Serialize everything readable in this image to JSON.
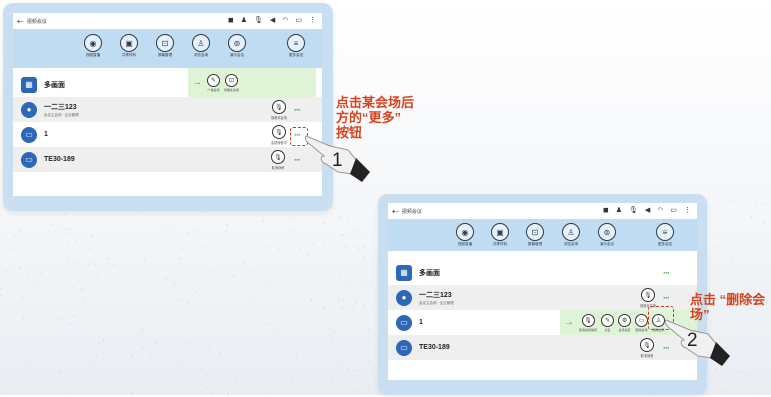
{
  "status": {
    "back_symbol": "⇠",
    "title": "视频会议"
  },
  "toolbar_labels": [
    "视频直播",
    "共享材料",
    "屏幕管理",
    "浏览会场",
    "演示会议",
    "更多会控"
  ],
  "toolbar_icons": [
    "camera-icon",
    "share-icon",
    "screen-icon",
    "participants-icon",
    "present-icon",
    "menu-icon"
  ],
  "rows": {
    "multi": {
      "name": "多画面",
      "more": "···"
    },
    "venue1": {
      "name": "一二三123",
      "sub": "会议主会场 · 企业管理",
      "more": "···",
      "mic_label": "静音本会场"
    },
    "venue2": {
      "name": "1",
      "more": "···",
      "mic_label": "会场静音中"
    },
    "venue3": {
      "name": "TE30-189",
      "more": "···",
      "mic_label": "取消静音"
    }
  },
  "slide1": {
    "labels": [
      "广播会场",
      "观看此会场"
    ]
  },
  "slide2": {
    "labels": [
      "取消会场静音",
      "点名",
      "会场设置",
      "删除会场",
      "删除会场"
    ]
  },
  "annotations": {
    "step1_text": "点击某会场后\n方的“更多”\n按钮",
    "step1_num": "1",
    "step2_text": "点击 “删除会\n场”",
    "step2_num": "2"
  },
  "colors": {
    "accent": "#2d67b8",
    "highlight": "#d13a1c",
    "callout": "#d6431c",
    "more": "#36b04a"
  }
}
